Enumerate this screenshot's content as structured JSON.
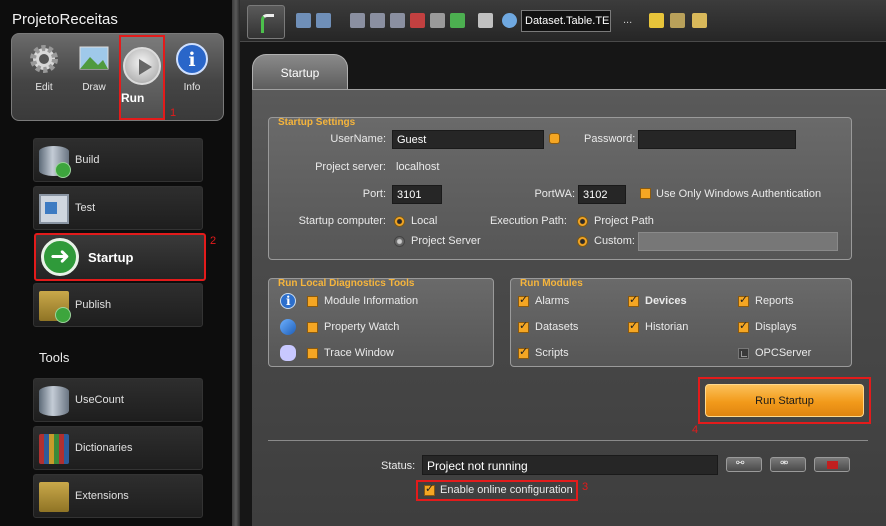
{
  "app": {
    "title": "ProjetoReceitas"
  },
  "modes": [
    {
      "label": "Edit",
      "icon": "gear-icon"
    },
    {
      "label": "Draw",
      "icon": "landscape-icon"
    },
    {
      "label": "Run",
      "icon": "play-icon"
    },
    {
      "label": "Info",
      "icon": "info-icon"
    }
  ],
  "annotations": {
    "n1": "1",
    "n2": "2",
    "n3": "3",
    "n4": "4"
  },
  "nav": {
    "build": "Build",
    "test": "Test",
    "startup": "Startup",
    "publish": "Publish"
  },
  "tools": {
    "heading": "Tools",
    "usecount": "UseCount",
    "dictionaries": "Dictionaries",
    "extensions": "Extensions"
  },
  "toolbar": {
    "combo_value": "Dataset.Table.TE",
    "more": "..."
  },
  "tab": {
    "label": "Startup"
  },
  "startup_settings": {
    "title": "Startup Settings",
    "username_label": "UserName:",
    "username_value": "Guest",
    "password_label": "Password:",
    "password_value": "",
    "project_server_label": "Project server:",
    "project_server_value": "localhost",
    "port_label": "Port:",
    "port_value": "3101",
    "portwa_label": "PortWA:",
    "portwa_value": "3102",
    "windows_auth_label": "Use Only Windows Authentication",
    "startup_computer_label": "Startup computer:",
    "local_label": "Local",
    "project_server_option": "Project Server",
    "execution_path_label": "Execution Path:",
    "project_path_label": "Project Path",
    "custom_label": "Custom:",
    "custom_value": ""
  },
  "diagnostics": {
    "title": "Run Local Diagnostics Tools",
    "module_information": "Module Information",
    "property_watch": "Property Watch",
    "trace_window": "Trace Window"
  },
  "run_modules": {
    "title": "Run Modules",
    "alarms": "Alarms",
    "devices": "Devices",
    "reports": "Reports",
    "datasets": "Datasets",
    "historian": "Historian",
    "displays": "Displays",
    "scripts": "Scripts",
    "opcserver": "OPCServer"
  },
  "actions": {
    "run_startup": "Run Startup"
  },
  "status": {
    "label": "Status:",
    "value": "Project not running",
    "online_config_label": "Enable online configuration"
  },
  "colors": {
    "accent": "#f5a623",
    "highlight": "#e31b1b"
  }
}
